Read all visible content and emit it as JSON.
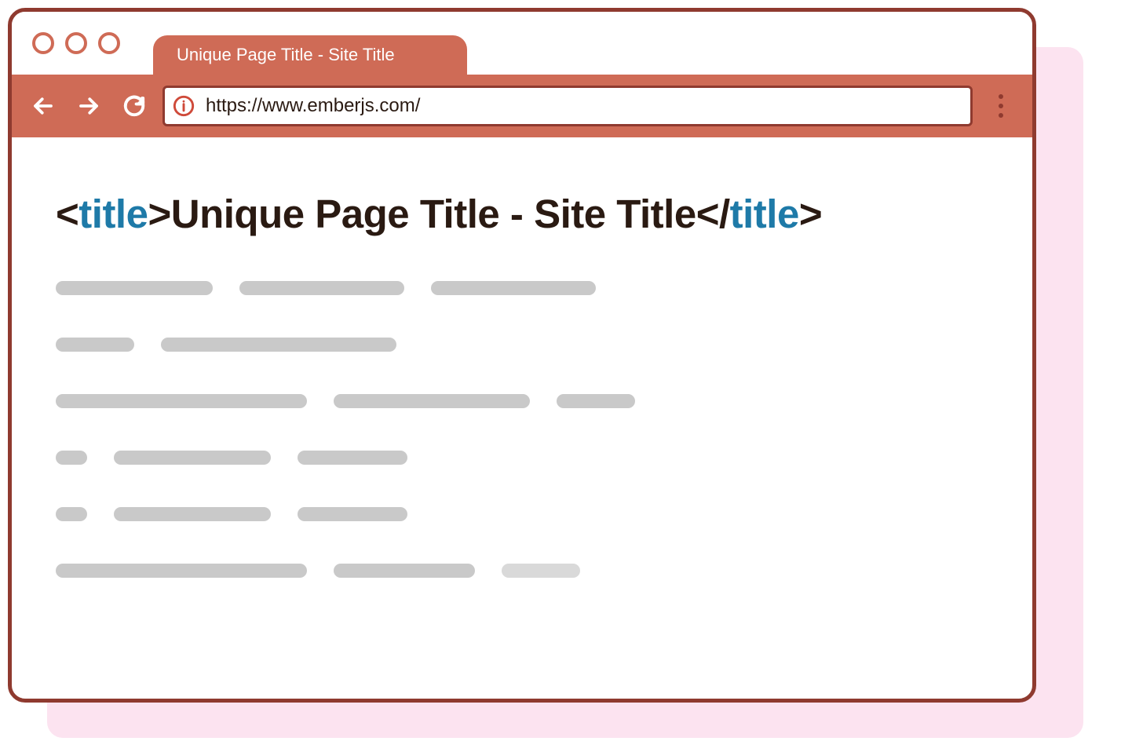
{
  "browser": {
    "tab_title": "Unique Page Title - Site Title",
    "url": "https://www.emberjs.com/"
  },
  "content": {
    "open_bracket": "<",
    "close_bracket": ">",
    "open_close_bracket": "</",
    "tag_name": "title",
    "title_text": "Unique Page Title - Site Title"
  },
  "placeholder_rows": [
    [
      200,
      210,
      210
    ],
    [
      100,
      300
    ],
    [
      320,
      250,
      100
    ],
    [
      40,
      200,
      140
    ],
    [
      40,
      200,
      140
    ],
    [
      320,
      180,
      100
    ]
  ]
}
